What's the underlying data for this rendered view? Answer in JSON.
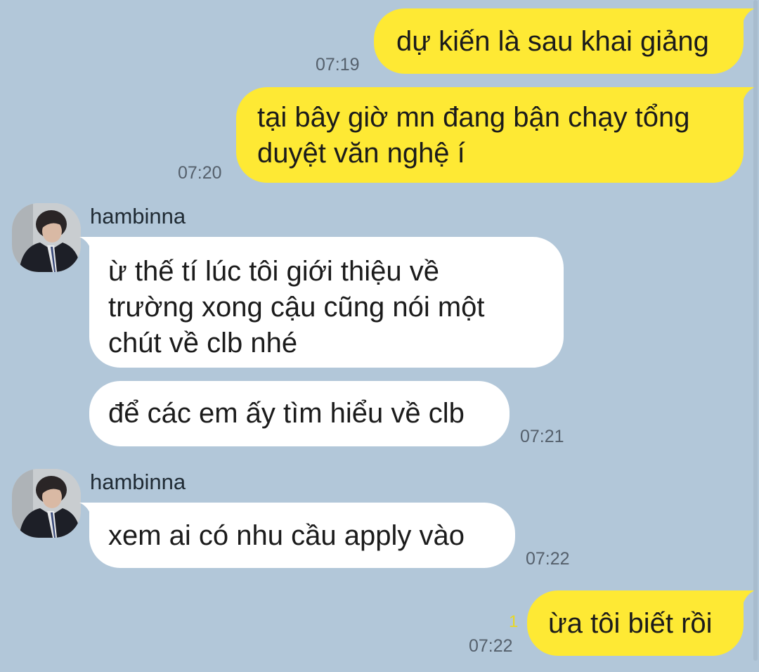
{
  "chat": {
    "messages": [
      {
        "text": "dự kiến là sau khai giảng",
        "time": "07:19"
      },
      {
        "text": "tại bây giờ mn đang bận chạy tổng\nduyệt văn nghệ í",
        "time": "07:20"
      },
      {
        "sender": "hambinna",
        "text": "ừ thế tí lúc tôi giới thiệu về\ntrường xong cậu cũng nói một\nchút về clb nhé"
      },
      {
        "text": "để các em ấy tìm hiểu về clb",
        "time": "07:21"
      },
      {
        "sender": "hambinna",
        "text": "xem ai có nhu cầu apply vào",
        "time": "07:22"
      },
      {
        "text": "ừa tôi biết rồi",
        "time": "07:22",
        "unread": "1"
      }
    ]
  },
  "colors": {
    "background": "#b2c7d9",
    "outgoing_bubble": "#fee934",
    "incoming_bubble": "#ffffff"
  },
  "icons": {
    "avatar": "profile-photo-avatar"
  }
}
